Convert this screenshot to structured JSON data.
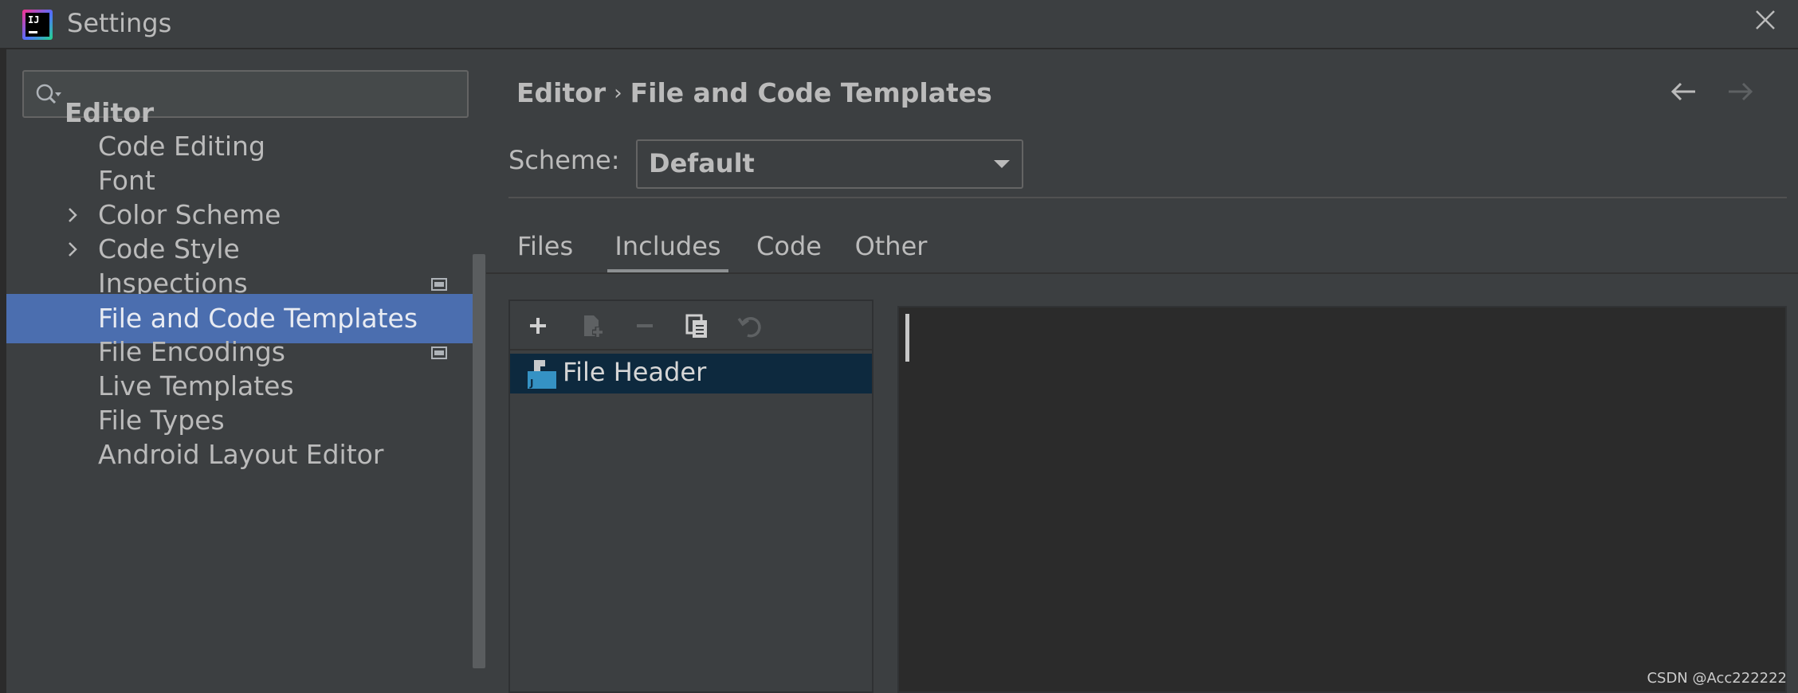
{
  "window": {
    "title": "Settings",
    "logo_text": "IJ"
  },
  "search": {
    "value": "",
    "placeholder": ""
  },
  "sidebar": {
    "items": [
      {
        "label": "Editor",
        "type": "header"
      },
      {
        "label": "Code Editing"
      },
      {
        "label": "Font"
      },
      {
        "label": "Color Scheme",
        "expandable": true
      },
      {
        "label": "Code Style",
        "expandable": true
      },
      {
        "label": "Inspections",
        "project_icon": true
      },
      {
        "label": "File and Code Templates",
        "selected": true
      },
      {
        "label": "File Encodings",
        "project_icon": true
      },
      {
        "label": "Live Templates"
      },
      {
        "label": "File Types"
      },
      {
        "label": "Android Layout Editor"
      }
    ]
  },
  "breadcrumb": {
    "parent": "Editor",
    "current": "File and Code Templates"
  },
  "scheme": {
    "label": "Scheme:",
    "value": "Default"
  },
  "tabs": [
    {
      "label": "Files"
    },
    {
      "label": "Includes",
      "active": true
    },
    {
      "label": "Code"
    },
    {
      "label": "Other"
    }
  ],
  "templates": {
    "items": [
      {
        "label": "File Header",
        "selected": true
      }
    ]
  },
  "watermark": "CSDN @Acc222222",
  "colors": {
    "background": "#3c3f41",
    "selection": "#4b6eaf",
    "list_selection": "#0d293e",
    "editor_bg": "#2b2b2b"
  }
}
